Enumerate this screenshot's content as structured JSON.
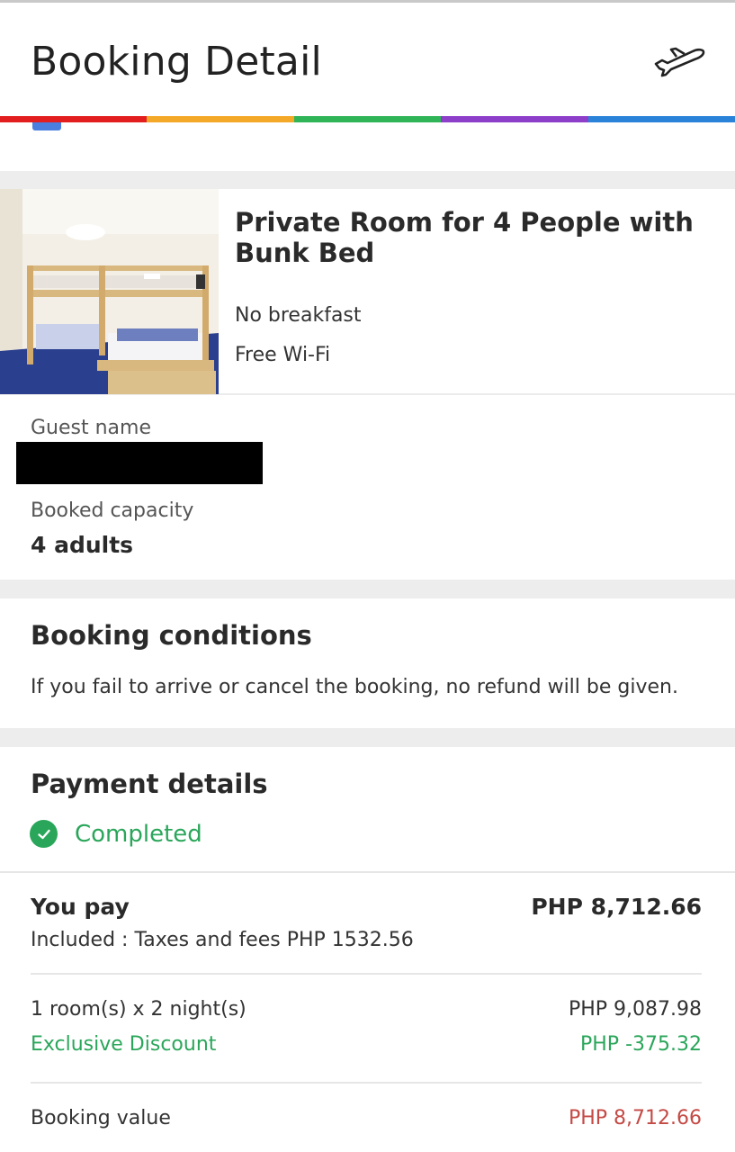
{
  "header": {
    "title": "Booking Detail",
    "icon": "airplane-icon"
  },
  "rainbow_colors": [
    "#e21e1e",
    "#f4a828",
    "#2fb457",
    "#8e3fc9",
    "#2a82d9"
  ],
  "room": {
    "name": "Private Room for 4 People with Bunk Bed",
    "features": [
      "No breakfast",
      "Free Wi-Fi"
    ]
  },
  "guest": {
    "name_label": "Guest name",
    "capacity_label": "Booked capacity",
    "capacity_value": "4 adults"
  },
  "conditions": {
    "title": "Booking conditions",
    "text": "If you fail to arrive or cancel the booking, no refund will be given."
  },
  "payment": {
    "title": "Payment details",
    "status": "Completed",
    "you_pay_label": "You pay",
    "you_pay_value": "PHP 8,712.66",
    "taxes_note": "Included : Taxes and fees PHP 1532.56",
    "room_nights_label": "1 room(s) x 2 night(s)",
    "room_nights_value": "PHP 9,087.98",
    "discount_label": "Exclusive Discount",
    "discount_value": "PHP -375.32",
    "booking_value_label": "Booking value",
    "booking_value_value": "PHP 8,712.66"
  },
  "colors": {
    "success_green": "#2aa65a",
    "booking_value_red": "#c44a45",
    "section_gap": "#ededed"
  }
}
